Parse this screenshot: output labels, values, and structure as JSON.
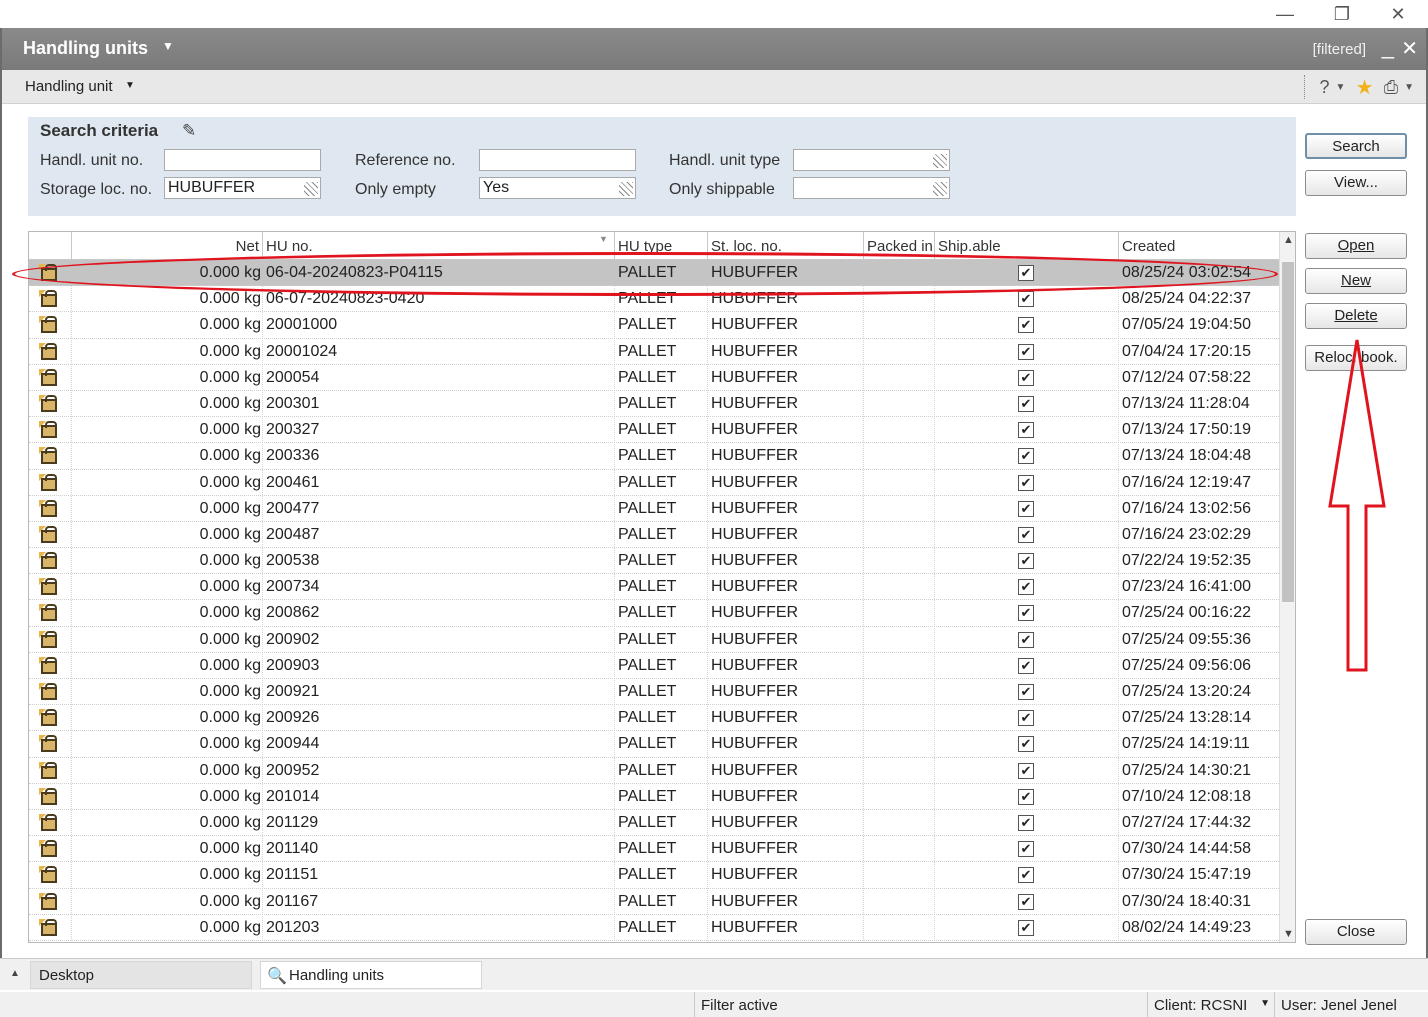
{
  "window": {
    "title": "Handling units",
    "filter_badge": "[filtered]"
  },
  "menubar": {
    "menu_label": "Handling unit"
  },
  "criteria": {
    "header": "Search criteria",
    "fields": {
      "hu_no_label": "Handl. unit no.",
      "hu_no_value": "",
      "ref_label": "Reference no.",
      "ref_value": "",
      "type_label": "Handl. unit type",
      "type_value": "",
      "storage_label": "Storage loc. no.",
      "storage_value": "HUBUFFER",
      "empty_label": "Only empty",
      "empty_value": "Yes",
      "ship_label": "Only shippable",
      "ship_value": ""
    }
  },
  "buttons": {
    "search": "Search",
    "view": "View...",
    "open": "Open",
    "new": "New",
    "delete": "Delete",
    "relocbook": "Reloc. book.",
    "close": "Close"
  },
  "table": {
    "headers": {
      "net": "Net",
      "hu_no": "HU no.",
      "hu_type": "HU type",
      "st_loc": "St. loc. no.",
      "packed": "Packed in",
      "shippable": "Ship.able",
      "created": "Created"
    },
    "rows": [
      {
        "net": "0.000 kg",
        "hu": "06-04-20240823-P04115",
        "type": "PALLET",
        "loc": "HUBUFFER",
        "created": "08/25/24 03:02:54",
        "selected": true
      },
      {
        "net": "0.000 kg",
        "hu": "06-07-20240823-0420",
        "type": "PALLET",
        "loc": "HUBUFFER",
        "created": "08/25/24 04:22:37"
      },
      {
        "net": "0.000 kg",
        "hu": "20001000",
        "type": "PALLET",
        "loc": "HUBUFFER",
        "created": "07/05/24 19:04:50"
      },
      {
        "net": "0.000 kg",
        "hu": "20001024",
        "type": "PALLET",
        "loc": "HUBUFFER",
        "created": "07/04/24 17:20:15"
      },
      {
        "net": "0.000 kg",
        "hu": "200054",
        "type": "PALLET",
        "loc": "HUBUFFER",
        "created": "07/12/24 07:58:22"
      },
      {
        "net": "0.000 kg",
        "hu": "200301",
        "type": "PALLET",
        "loc": "HUBUFFER",
        "created": "07/13/24 11:28:04"
      },
      {
        "net": "0.000 kg",
        "hu": "200327",
        "type": "PALLET",
        "loc": "HUBUFFER",
        "created": "07/13/24 17:50:19"
      },
      {
        "net": "0.000 kg",
        "hu": "200336",
        "type": "PALLET",
        "loc": "HUBUFFER",
        "created": "07/13/24 18:04:48"
      },
      {
        "net": "0.000 kg",
        "hu": "200461",
        "type": "PALLET",
        "loc": "HUBUFFER",
        "created": "07/16/24 12:19:47"
      },
      {
        "net": "0.000 kg",
        "hu": "200477",
        "type": "PALLET",
        "loc": "HUBUFFER",
        "created": "07/16/24 13:02:56"
      },
      {
        "net": "0.000 kg",
        "hu": "200487",
        "type": "PALLET",
        "loc": "HUBUFFER",
        "created": "07/16/24 23:02:29"
      },
      {
        "net": "0.000 kg",
        "hu": "200538",
        "type": "PALLET",
        "loc": "HUBUFFER",
        "created": "07/22/24 19:52:35"
      },
      {
        "net": "0.000 kg",
        "hu": "200734",
        "type": "PALLET",
        "loc": "HUBUFFER",
        "created": "07/23/24 16:41:00"
      },
      {
        "net": "0.000 kg",
        "hu": "200862",
        "type": "PALLET",
        "loc": "HUBUFFER",
        "created": "07/25/24 00:16:22"
      },
      {
        "net": "0.000 kg",
        "hu": "200902",
        "type": "PALLET",
        "loc": "HUBUFFER",
        "created": "07/25/24 09:55:36"
      },
      {
        "net": "0.000 kg",
        "hu": "200903",
        "type": "PALLET",
        "loc": "HUBUFFER",
        "created": "07/25/24 09:56:06"
      },
      {
        "net": "0.000 kg",
        "hu": "200921",
        "type": "PALLET",
        "loc": "HUBUFFER",
        "created": "07/25/24 13:20:24"
      },
      {
        "net": "0.000 kg",
        "hu": "200926",
        "type": "PALLET",
        "loc": "HUBUFFER",
        "created": "07/25/24 13:28:14"
      },
      {
        "net": "0.000 kg",
        "hu": "200944",
        "type": "PALLET",
        "loc": "HUBUFFER",
        "created": "07/25/24 14:19:11"
      },
      {
        "net": "0.000 kg",
        "hu": "200952",
        "type": "PALLET",
        "loc": "HUBUFFER",
        "created": "07/25/24 14:30:21"
      },
      {
        "net": "0.000 kg",
        "hu": "201014",
        "type": "PALLET",
        "loc": "HUBUFFER",
        "created": "07/10/24 12:08:18"
      },
      {
        "net": "0.000 kg",
        "hu": "201129",
        "type": "PALLET",
        "loc": "HUBUFFER",
        "created": "07/27/24 17:44:32"
      },
      {
        "net": "0.000 kg",
        "hu": "201140",
        "type": "PALLET",
        "loc": "HUBUFFER",
        "created": "07/30/24 14:44:58"
      },
      {
        "net": "0.000 kg",
        "hu": "201151",
        "type": "PALLET",
        "loc": "HUBUFFER",
        "created": "07/30/24 15:47:19"
      },
      {
        "net": "0.000 kg",
        "hu": "201167",
        "type": "PALLET",
        "loc": "HUBUFFER",
        "created": "07/30/24 18:40:31"
      },
      {
        "net": "0.000 kg",
        "hu": "201203",
        "type": "PALLET",
        "loc": "HUBUFFER",
        "created": "08/02/24 14:49:23"
      }
    ]
  },
  "tabs": {
    "desktop": "Desktop",
    "handling_units": "Handling units"
  },
  "status": {
    "filter": "Filter active",
    "client": "Client: RCSNI",
    "user": "User: Jenel Jenel"
  },
  "colors": {
    "annotation_red": "#e0141e",
    "title_bar": "#808080",
    "criteria_bg": "#dfe8f0",
    "selected_row": "#c4c4c4"
  }
}
